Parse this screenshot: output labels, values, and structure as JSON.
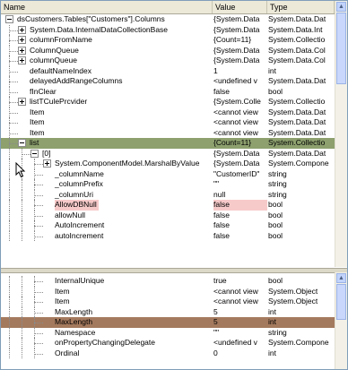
{
  "columns": {
    "name": "Name",
    "value": "Value",
    "type": "Type"
  },
  "top_rows": [
    {
      "indent": 0,
      "exp": "minus",
      "name": "dsCustomers.Tables[\"Customers\"].Columns",
      "value": "{System.Data",
      "type": "System.Data.Dat"
    },
    {
      "indent": 1,
      "exp": "plus",
      "name": "System.Data.InternalDataCollectionBase",
      "value": "{System.Data",
      "type": "System.Data.Int"
    },
    {
      "indent": 1,
      "exp": "plus",
      "name": "columnFromName",
      "value": "{Count=11}",
      "type": "System.Collectio"
    },
    {
      "indent": 1,
      "exp": "plus",
      "name": "ColumnQueue",
      "value": "{System.Data",
      "type": "System.Data.Col"
    },
    {
      "indent": 1,
      "exp": "plus",
      "name": "columnQueue",
      "value": "{System.Data",
      "type": "System.Data.Col"
    },
    {
      "indent": 1,
      "exp": "",
      "name": "defaultNameIndex",
      "value": "1",
      "type": "int"
    },
    {
      "indent": 1,
      "exp": "",
      "name": "delayedAddRangeColumns",
      "value": "<undefined v",
      "type": "System.Data.Dat"
    },
    {
      "indent": 1,
      "exp": "",
      "name": "fInClear",
      "value": "false",
      "type": "bool"
    },
    {
      "indent": 1,
      "exp": "plus",
      "name": "listTCulePrcvider",
      "value": "{System.Colle",
      "type": "System.Collectio"
    },
    {
      "indent": 1,
      "exp": "",
      "name": "Item",
      "value": "<cannot view",
      "type": "System.Data.Dat"
    },
    {
      "indent": 1,
      "exp": "",
      "name": "Item",
      "value": "<cannot view",
      "type": "System.Data.Dat"
    },
    {
      "indent": 1,
      "exp": "",
      "name": "Item",
      "value": "<cannot view",
      "type": "System.Data.Dat"
    },
    {
      "indent": 1,
      "exp": "minus",
      "name": "list",
      "value": "{Count=11}",
      "type": "System.Collectio",
      "state": "selected"
    },
    {
      "indent": 2,
      "exp": "minus",
      "name": "[0]",
      "value": "{System.Data",
      "type": "System.Data.Dat"
    },
    {
      "indent": 3,
      "exp": "plus",
      "name": "System.ComponentModel.MarshalByValue",
      "value": "{System.Data",
      "type": "System.Compone"
    },
    {
      "indent": 3,
      "exp": "",
      "name": "_columnName",
      "value": "\"CustomerID\"",
      "type": "string"
    },
    {
      "indent": 3,
      "exp": "",
      "name": "_columnPrefix",
      "value": "\"\"",
      "type": "string"
    },
    {
      "indent": 3,
      "exp": "",
      "name": "_columnUri",
      "value": "null",
      "type": "string"
    },
    {
      "indent": 3,
      "exp": "",
      "name": "AllowDBNull",
      "value": "false",
      "type": "bool",
      "state": "pink"
    },
    {
      "indent": 3,
      "exp": "",
      "name": "allowNull",
      "value": "false",
      "type": "bool"
    },
    {
      "indent": 3,
      "exp": "",
      "name": "AutoIncrement",
      "value": "false",
      "type": "bool"
    },
    {
      "indent": 3,
      "exp": "",
      "name": "autoIncrement",
      "value": "false",
      "type": "bool"
    }
  ],
  "bottom_rows": [
    {
      "indent": 3,
      "exp": "",
      "name": "InternalUnique",
      "value": "true",
      "type": "bool"
    },
    {
      "indent": 3,
      "exp": "",
      "name": "Item",
      "value": "<cannot view",
      "type": "System.Object"
    },
    {
      "indent": 3,
      "exp": "",
      "name": "Item",
      "value": "<cannot view",
      "type": "System.Object"
    },
    {
      "indent": 3,
      "exp": "",
      "name": "MaxLength",
      "value": "5",
      "type": "int"
    },
    {
      "indent": 3,
      "exp": "",
      "name": "MaxLength",
      "value": "5",
      "type": "int",
      "state": "brown"
    },
    {
      "indent": 3,
      "exp": "",
      "name": "Namespace",
      "value": "\"\"",
      "type": "string"
    },
    {
      "indent": 3,
      "exp": "",
      "name": "onPropertyChangingDelegate",
      "value": "<undefined v",
      "type": "System.Compone"
    },
    {
      "indent": 3,
      "exp": "",
      "name": "Ordinal",
      "value": "0",
      "type": "int"
    }
  ]
}
